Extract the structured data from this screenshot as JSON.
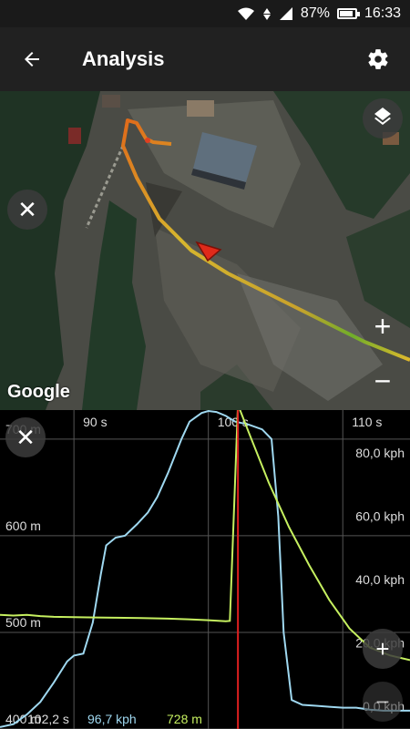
{
  "status_bar": {
    "battery": "87%",
    "time": "16:33",
    "battery_level": 0.87
  },
  "app_bar": {
    "title": "Analysis",
    "back_icon": "arrow-left-icon",
    "settings_icon": "gear-icon"
  },
  "map": {
    "attribution": "Google",
    "zoom_in_label": "+",
    "zoom_out_label": "−",
    "close_label": "✕",
    "layers_icon": "layers-icon"
  },
  "chart": {
    "close_label": "✕",
    "zoom_in_label": "+",
    "zoom_out_label": "−",
    "cursor_readout": {
      "time": "102,2 s",
      "speed": "96,7 kph",
      "elevation": "728 m"
    },
    "colors": {
      "elevation": "#9fd8f0",
      "speed": "#c6f060",
      "cursor": "#e02020"
    }
  },
  "chart_data": {
    "type": "line",
    "x_tick_labels": [
      "90 s",
      "100 s",
      "110 s"
    ],
    "x_ticks": [
      90,
      100,
      110
    ],
    "xlim": [
      84.5,
      115
    ],
    "elevation_tick_labels": [
      "700 m",
      "600 m",
      "500 m",
      "400 m"
    ],
    "elevation_ticks": [
      700,
      600,
      500,
      400
    ],
    "elevation_lim": [
      400,
      730
    ],
    "speed_tick_labels": [
      "80,0 kph",
      "60,0 kph",
      "40,0 kph",
      "20,0 kph",
      "0,0 kph"
    ],
    "speed_ticks": [
      80,
      60,
      40,
      20,
      0
    ],
    "speed_lim": [
      0,
      95
    ],
    "cursor_x": 102.2,
    "series": [
      {
        "x": [
          84.5,
          85.5,
          86.5,
          87.5,
          88.5,
          89.5,
          90.0,
          90.7,
          91.4,
          92.0,
          92.4,
          93.1,
          93.8,
          94.7,
          95.5,
          96.2,
          97.0,
          98.0,
          98.6,
          99.0,
          99.5,
          100.0,
          100.6,
          101.3,
          102.0,
          103.0,
          104.0,
          104.7,
          105.2,
          105.6,
          106.2,
          107.0,
          108.0,
          109.0,
          110.0,
          111.0,
          112.0,
          113.0,
          114.0,
          115.0
        ],
        "values": [
          402,
          405,
          415,
          428,
          448,
          470,
          476,
          478,
          510,
          560,
          590,
          598,
          600,
          612,
          624,
          640,
          665,
          700,
          718,
          722,
          727,
          729,
          728,
          724,
          718,
          715,
          710,
          700,
          620,
          500,
          430,
          425,
          424,
          423,
          422,
          422,
          420,
          419,
          419,
          419
        ]
      },
      {
        "x": [
          84.5,
          85.5,
          86.5,
          87.5,
          88.5,
          89.5,
          91.0,
          93.0,
          95.0,
          97.0,
          98.5,
          100.0,
          101.3,
          101.6,
          102.2,
          103.0,
          104.5,
          106.0,
          107.5,
          109.0,
          110.5,
          112.0,
          113.5,
          115.0
        ],
        "values": [
          30.3,
          30.1,
          30.3,
          29.9,
          29.7,
          29.6,
          29.5,
          29.4,
          29.3,
          29.1,
          28.9,
          28.6,
          28.3,
          28.4,
          96.7,
          88.0,
          72.0,
          58.0,
          46.0,
          35.0,
          26.0,
          20.0,
          17.5,
          16.0
        ]
      }
    ]
  }
}
